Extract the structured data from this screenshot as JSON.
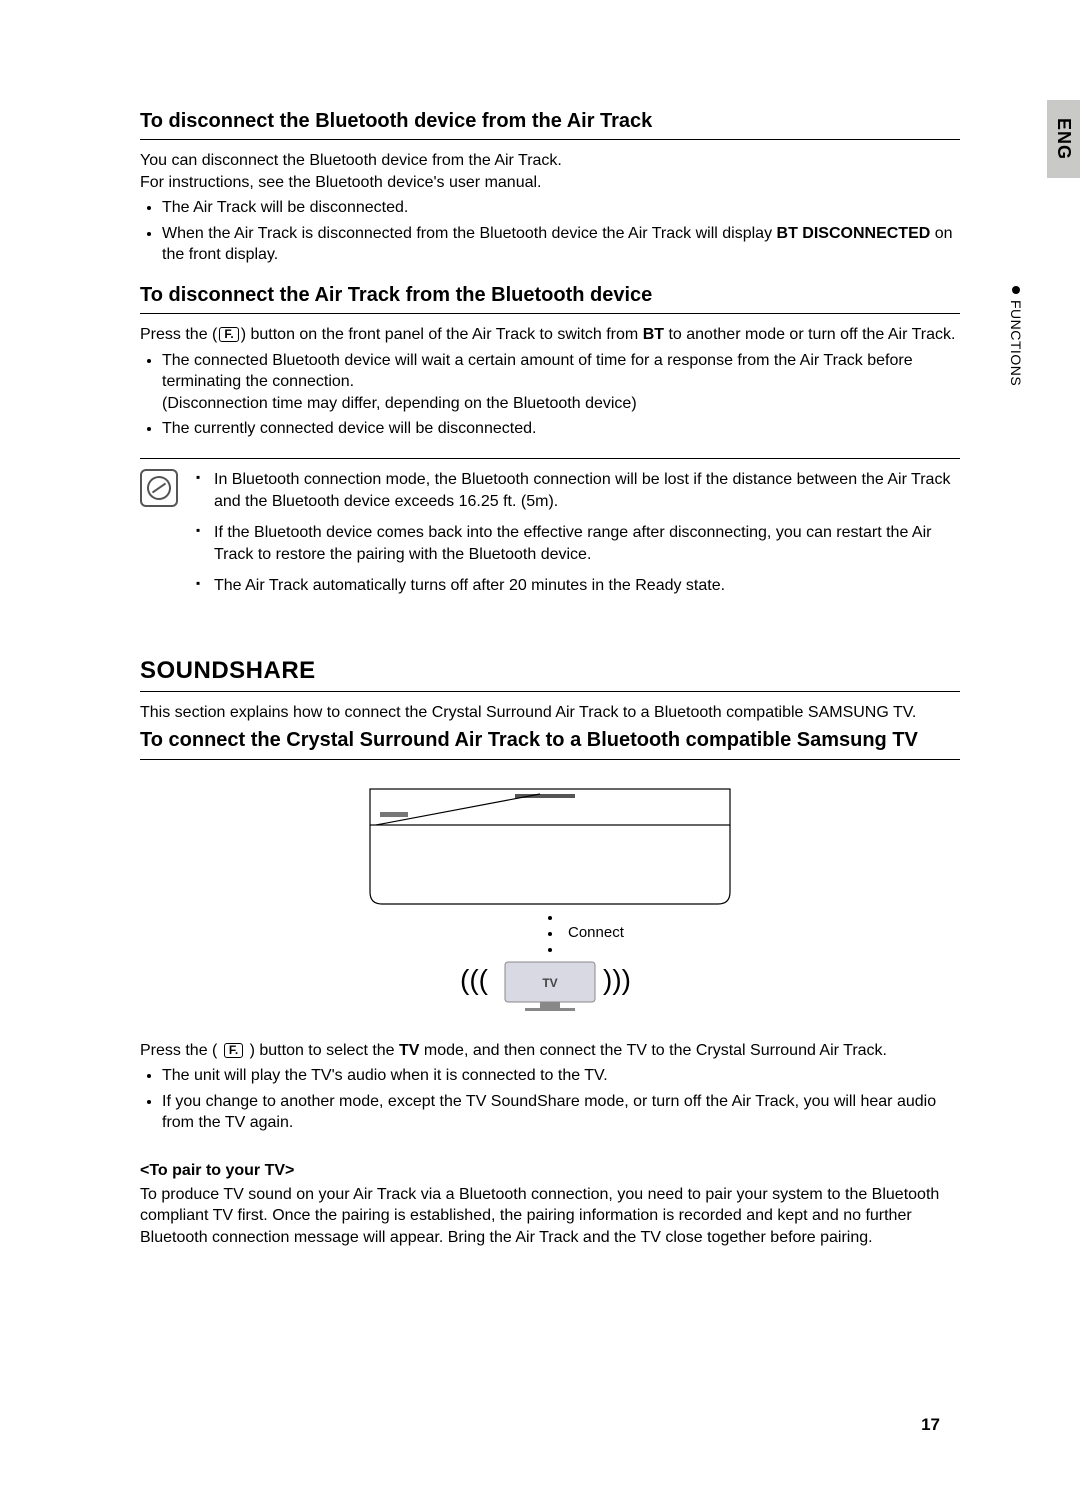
{
  "side": {
    "lang_tab": "ENG",
    "section_label": "FUNCTIONS"
  },
  "sections": {
    "s1": {
      "heading": "To disconnect the Bluetooth device from the Air Track",
      "p1": "You can disconnect the Bluetooth device from the Air Track.",
      "p2": "For instructions, see the Bluetooth device's user manual.",
      "b1": "The Air Track will be disconnected.",
      "b2a": "When the Air Track is disconnected from the Bluetooth device the Air Track will display ",
      "b2b": "BT DISCONNECTED",
      "b2c": " on the front display."
    },
    "s2": {
      "heading": "To disconnect the Air Track from the Bluetooth device",
      "p1a": "Press the (",
      "p1b": ") button on the front panel of the Air Track to switch from ",
      "p1c": "BT",
      "p1d": " to another mode or turn off the Air Track.",
      "fbtn": "F.",
      "b1": "The connected Bluetooth device will wait a certain amount of time for a response from the Air Track before terminating the connection.",
      "b1sub": "(Disconnection time may differ, depending on the Bluetooth device)",
      "b2": "The currently connected device will be disconnected."
    },
    "notes": {
      "n1": "In Bluetooth connection mode, the Bluetooth connection will be lost if the distance between the Air Track and the Bluetooth device exceeds 16.25 ft. (5m).",
      "n2": "If the Bluetooth device comes back into the effective range after disconnecting, you can restart the Air Track to restore the pairing with the Bluetooth device.",
      "n3": "The Air Track automatically turns off after 20 minutes in the Ready state."
    },
    "soundshare": {
      "title": "SOUNDSHARE",
      "intro": "This section explains how to connect the Crystal Surround Air Track to a Bluetooth compatible SAMSUNG TV.",
      "h3": "To connect the Crystal Surround Air Track to a Bluetooth compatible Samsung TV",
      "diagram_connect": "Connect",
      "diagram_tv": "TV",
      "p_after_a": "Press the ( ",
      "p_after_fbtn": "F.",
      "p_after_b": " ) button to select the ",
      "p_after_c": "TV",
      "p_after_d": " mode, and then connect the TV to the Crystal Surround Air Track.",
      "b1": "The unit will play the TV's audio when it is connected to the TV.",
      "b2": "If you change to another mode, except the TV SoundShare mode, or turn off the Air Track, you will hear audio from the TV again.",
      "pair_h": "<To pair to your TV>",
      "pair_p": "To produce TV sound on your Air Track via a Bluetooth connection, you need to pair your system to the Bluetooth compliant TV first. Once the pairing is established, the pairing information is recorded and kept and no further Bluetooth connection message will appear. Bring the Air Track and the TV close together before pairing."
    }
  },
  "page_number": "17"
}
